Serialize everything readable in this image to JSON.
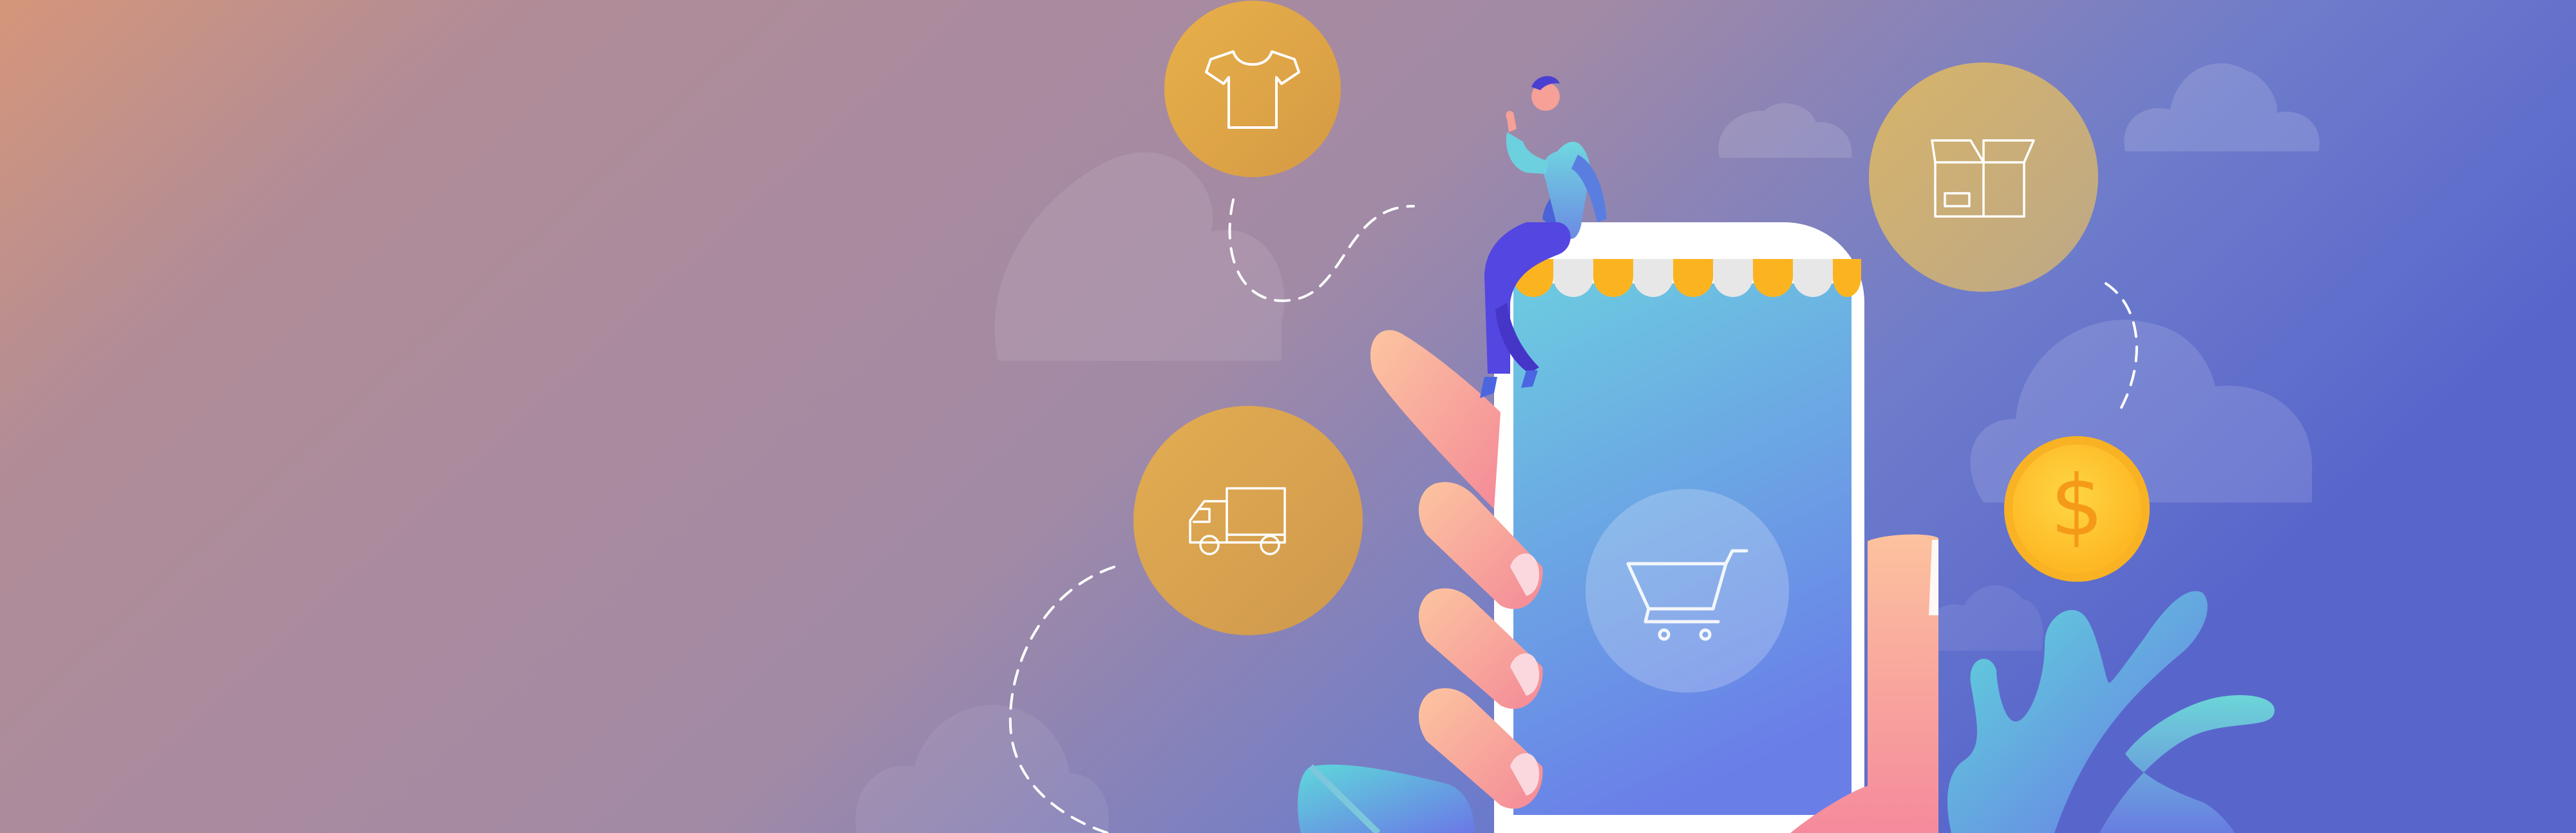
{
  "scene": {
    "description_icons": [
      "tshirt-icon",
      "delivery-truck-icon",
      "shopping-cart-icon",
      "box-package-icon",
      "dollar-coin-icon"
    ],
    "coin_symbol": "$",
    "colors": {
      "bg_left": "#D5967A",
      "bg_mid": "#A98A9E",
      "bg_right": "#5B6CCF",
      "bubble_gold": "#E1A94A",
      "phone_screen_top": "#6BC8E2",
      "phone_screen_bottom": "#6A80E8",
      "awning_orange": "#FBB420",
      "coin_yellow": "#FFC728",
      "skin": "#F6A098",
      "leaf_teal": "#6ADCDC"
    }
  }
}
